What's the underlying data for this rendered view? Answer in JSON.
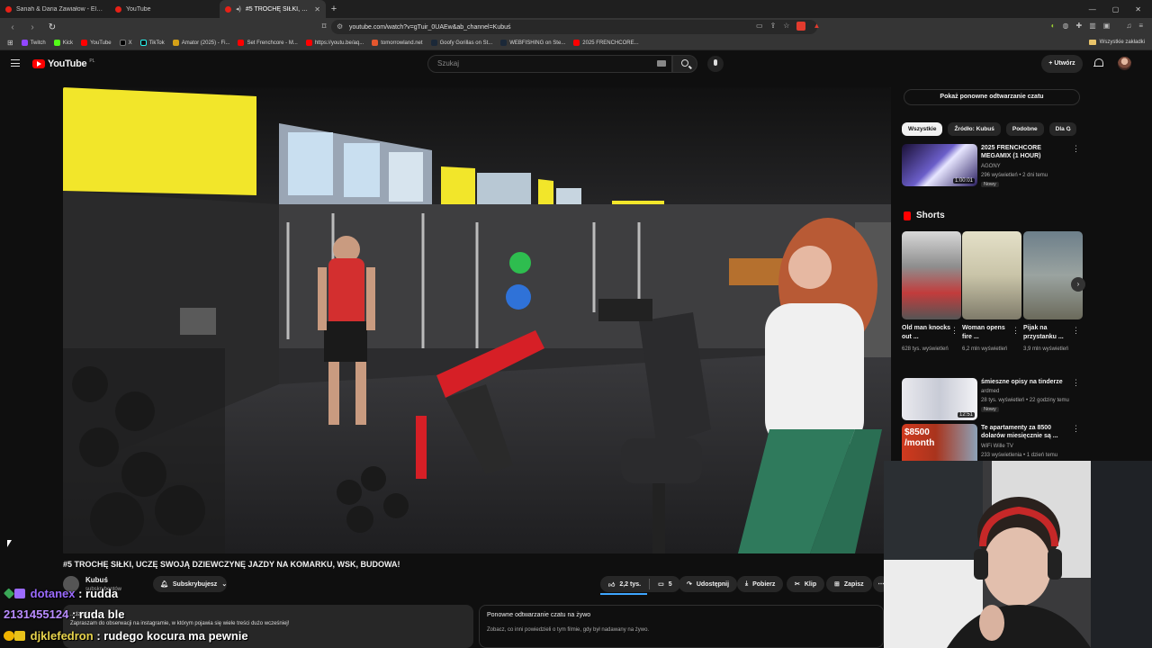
{
  "browser": {
    "tabs": [
      {
        "title": "Sanah & Daria Zawiałow - Eldorado"
      },
      {
        "title": "YouTube"
      },
      {
        "title": "#5 TROCHĘ SIŁKI, UCZĘ SWO..."
      }
    ],
    "url": "youtube.com/watch?v=gTuir_0UAEw&ab_channel=Kubuś",
    "bookmarks": [
      "Twitch",
      "Kick",
      "YouTube",
      "X",
      "TikTok",
      "Amator (2025) - Fi...",
      "Set Frenchcore - M...",
      "https://youtu.be/aq...",
      "tomorrowland.net",
      "Goofy Gorillas on St...",
      "WEBFISHING on Ste...",
      "2025 FRENCHCORE..."
    ],
    "all_bookmarks": "Wszystkie zakładki"
  },
  "yt": {
    "logo": "YouTube",
    "country": "PL",
    "search_placeholder": "Szukaj",
    "create_label": "Utwórz"
  },
  "video": {
    "title": "#5 TROCHĘ SIŁKI, UCZĘ SWOJĄ DZIEWCZYNĘ JAZDY NA KOMARKU, WSK, BUDOWA!",
    "channel": "Kubuś",
    "subs": "subskrybentów",
    "subscribe_label": "Subskrybujesz",
    "likes": "2,2 tys.",
    "comments": "5",
    "share": "Udostępnij",
    "download": "Pobierz",
    "clip": "Klip",
    "save": "Zapisz",
    "desc_line1": "...dzień temu",
    "desc_line2": "Zapraszam do obserwacji na instagramie, w którym pojawia się wiele treści dużo wcześniej!",
    "replay_title": "Ponowne odtwarzanie czatu na żywo",
    "replay_sub": "Zobacz, co inni powiedzieli o tym filmie, gdy był nadawany na żywo."
  },
  "sidebar": {
    "chat_replay_btn": "Pokaż ponowne odtwarzanie czatu",
    "chips": [
      "Wszystkie",
      "Źródło: Kubuś",
      "Podobne",
      "Dla C"
    ],
    "rec1": {
      "title": "2025 FRENCHCORE MEGAMIX (1 HOUR)",
      "channel": "AGONY",
      "meta": "296 wyświetleń • 2 dni temu",
      "badge": "Nowy",
      "duration": "1:00:01"
    },
    "shorts_label": "Shorts",
    "shorts": [
      {
        "title": "Old man knocks out ...",
        "views": "628 tys. wyświetleń"
      },
      {
        "title": "Woman opens fire ...",
        "views": "6,2 mln wyświetleń"
      },
      {
        "title": "Pijak na przystanku ...",
        "views": "3,9 mln wyświetleń"
      }
    ],
    "rec2": {
      "title": "śmieszne opisy na tinderze",
      "channel": "ardmed",
      "meta": "28 tys. wyświetleń • 22 godziny temu",
      "badge": "Nowy",
      "duration": "12:51"
    },
    "rec3": {
      "title": "Te apartamenty za 8500 dolarów miesięcznie są ...",
      "channel": "WiFi Wille TV",
      "meta": "233 wyświetlenia • 1 dzień temu",
      "thumb_text": "$8500 /month"
    }
  },
  "chat": [
    {
      "user": "dotanex",
      "text": " : rudda",
      "color": "#9b6bff"
    },
    {
      "user": "2131455124",
      "text": " : ruda ble",
      "color": "#b98cff"
    },
    {
      "user": "djklefedron",
      "text": " : rudego kocura ma pewnie",
      "color": "#e8d44d"
    }
  ]
}
